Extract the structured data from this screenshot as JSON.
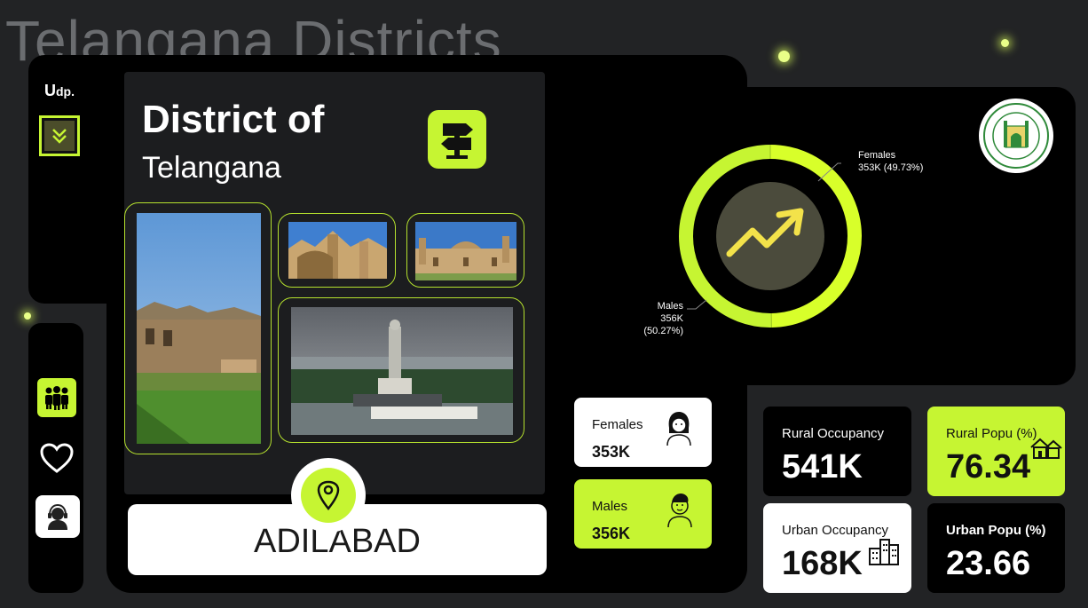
{
  "page": {
    "background_title": "Telangana Districts"
  },
  "brand": {
    "logo_main": "U",
    "logo_suffix": "dp."
  },
  "header": {
    "title_line1": "District of",
    "title_line2": "Telangana"
  },
  "district": {
    "name": "ADILABAD"
  },
  "gender_cards": {
    "females": {
      "label": "Females",
      "value": "353K"
    },
    "males": {
      "label": "Males",
      "value": "356K"
    }
  },
  "stats": {
    "rural_occupancy": {
      "label": "Rural Occupancy",
      "value": "541K"
    },
    "rural_popu": {
      "label": "Rural Popu (%)",
      "value": "76.34"
    },
    "urban_occupancy": {
      "label": "Urban Occupancy",
      "value": "168K"
    },
    "urban_popu": {
      "label": "Urban Popu (%)",
      "value": "23.66"
    }
  },
  "chart_data": {
    "type": "donut",
    "series": [
      {
        "name": "Females",
        "value": 353,
        "label": "353K (49.73%)",
        "percent": 49.73
      },
      {
        "name": "Males",
        "value": 356,
        "label": "356K (50.27%)",
        "percent": 50.27
      }
    ]
  },
  "icons": [
    "chevron-double-down-icon",
    "users-icon",
    "heart-icon",
    "support-agent-icon",
    "signpost-icon",
    "location-pin-icon",
    "trend-up-icon",
    "female-face-icon",
    "male-face-icon",
    "houses-icon",
    "buildings-icon",
    "telangana-emblem-icon"
  ],
  "colors": {
    "accent": "#c6f532",
    "panel": "#000000",
    "background": "#222325"
  }
}
